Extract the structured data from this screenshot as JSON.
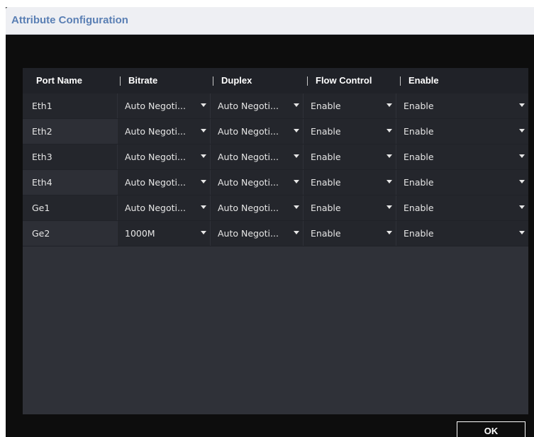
{
  "dialog": {
    "title": "Attribute Configuration"
  },
  "table": {
    "headers": [
      "Port Name",
      "Bitrate",
      "Duplex",
      "Flow Control",
      "Enable"
    ],
    "rows": [
      {
        "port": "Eth1",
        "bitrate": "Auto Negoti...",
        "duplex": "Auto Negoti...",
        "flow_control": "Enable",
        "enable": "Enable"
      },
      {
        "port": "Eth2",
        "bitrate": "Auto Negoti...",
        "duplex": "Auto Negoti...",
        "flow_control": "Enable",
        "enable": "Enable"
      },
      {
        "port": "Eth3",
        "bitrate": "Auto Negoti...",
        "duplex": "Auto Negoti...",
        "flow_control": "Enable",
        "enable": "Enable"
      },
      {
        "port": "Eth4",
        "bitrate": "Auto Negoti...",
        "duplex": "Auto Negoti...",
        "flow_control": "Enable",
        "enable": "Enable"
      },
      {
        "port": "Ge1",
        "bitrate": "Auto Negoti...",
        "duplex": "Auto Negoti...",
        "flow_control": "Enable",
        "enable": "Enable"
      },
      {
        "port": "Ge2",
        "bitrate": "1000M",
        "duplex": "Auto Negoti...",
        "flow_control": "Enable",
        "enable": "Enable"
      }
    ]
  },
  "footer": {
    "ok_label": "OK"
  },
  "icons": {
    "dropdown": "chevron-down-icon"
  },
  "colors": {
    "title_text": "#5a7fb4",
    "table_bg": "#2f3138",
    "header_bg": "#202228"
  }
}
